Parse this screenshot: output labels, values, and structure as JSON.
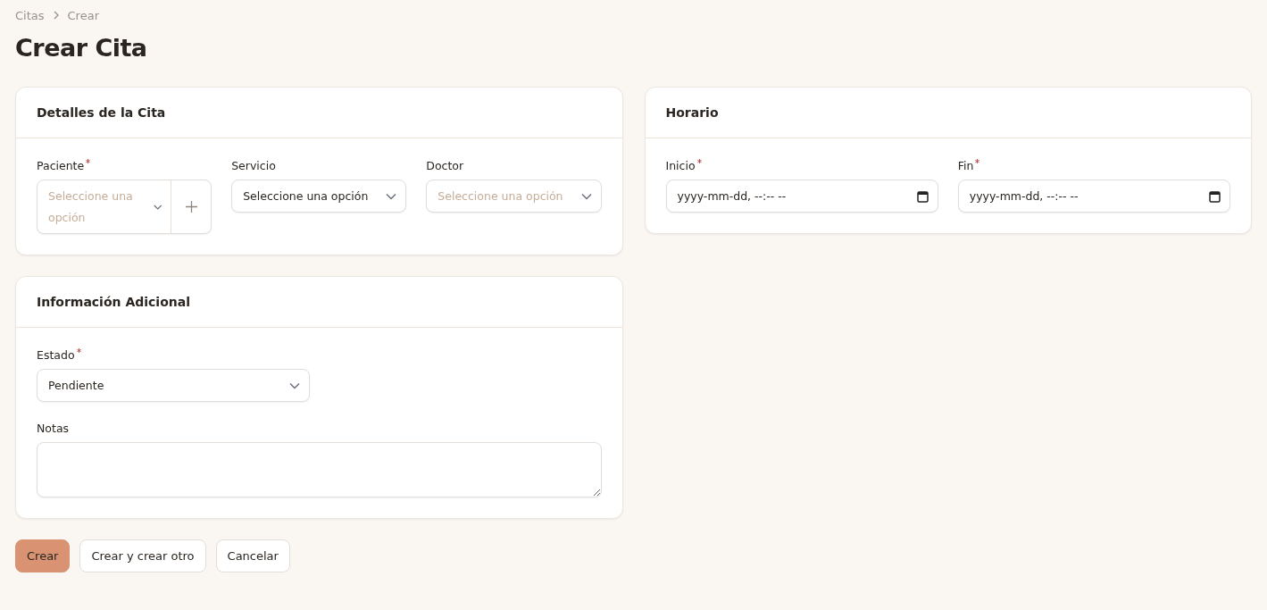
{
  "breadcrumb": [
    "Citas",
    "Crear"
  ],
  "title": "Crear Cita",
  "sections": [
    {
      "title": "Detalles de la Cita",
      "fields": [
        {
          "kind": "select-add",
          "label": "Paciente",
          "required": true,
          "placeholder": "Seleccione una opción"
        },
        {
          "kind": "select",
          "label": "Servicio",
          "required": false,
          "value": "Seleccione una opción"
        },
        {
          "kind": "select",
          "label": "Doctor",
          "required": false,
          "placeholder": "Seleccione una opción"
        }
      ]
    },
    {
      "title": "Horario",
      "fields": [
        {
          "kind": "datetime",
          "label": "Inicio",
          "required": true,
          "value": "yyyy-mm-dd, --:-- --"
        },
        {
          "kind": "datetime",
          "label": "Fin",
          "required": true,
          "value": "yyyy-mm-dd, --:-- --"
        }
      ]
    },
    {
      "title": "Información Adicional",
      "fields": [
        {
          "kind": "select",
          "label": "Estado",
          "required": true,
          "value": "Pendiente"
        },
        {
          "kind": "textarea",
          "label": "Notas",
          "required": false
        }
      ]
    }
  ],
  "buttons": [
    {
      "label": "Crear",
      "primary": true
    },
    {
      "label": "Crear y crear otro",
      "primary": false
    },
    {
      "label": "Cancelar",
      "primary": false
    }
  ]
}
